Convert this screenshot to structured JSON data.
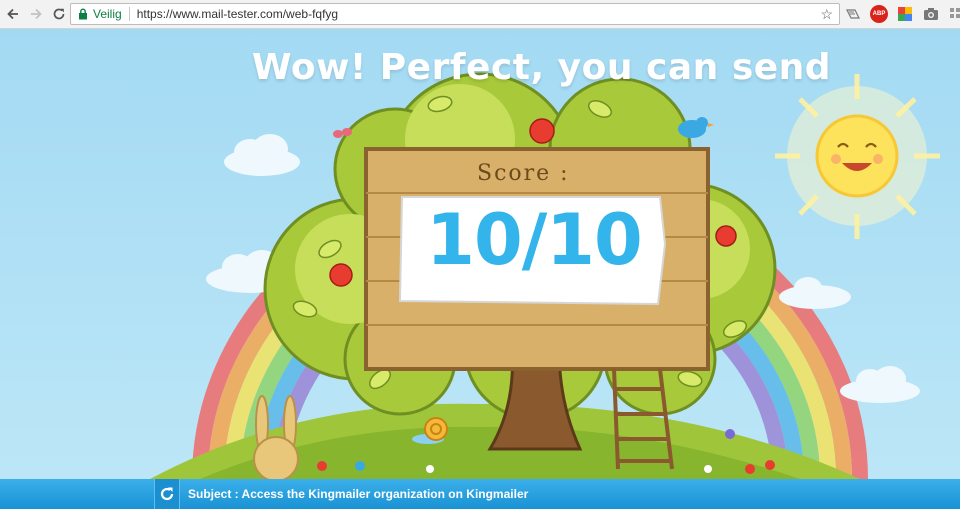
{
  "browser": {
    "secure_label": "Veilig",
    "url": "https://www.mail-tester.com/web-fqfyg",
    "extensions": [
      "reader-icon",
      "adblock-icon",
      "google-icon",
      "camera-icon",
      "grid-icon"
    ],
    "adblock_label": "ABP"
  },
  "page": {
    "headline": "Wow! Perfect, you can send",
    "score_label": "Score :",
    "score_value": "10/10",
    "subject_text": "Subject : Access the Kingmailer organization on Kingmailer"
  },
  "colors": {
    "sky": "#a9dcf2",
    "score_blue": "#33b4ea",
    "subject_bar": "#1f9bdb",
    "board": "#d4a55a"
  }
}
